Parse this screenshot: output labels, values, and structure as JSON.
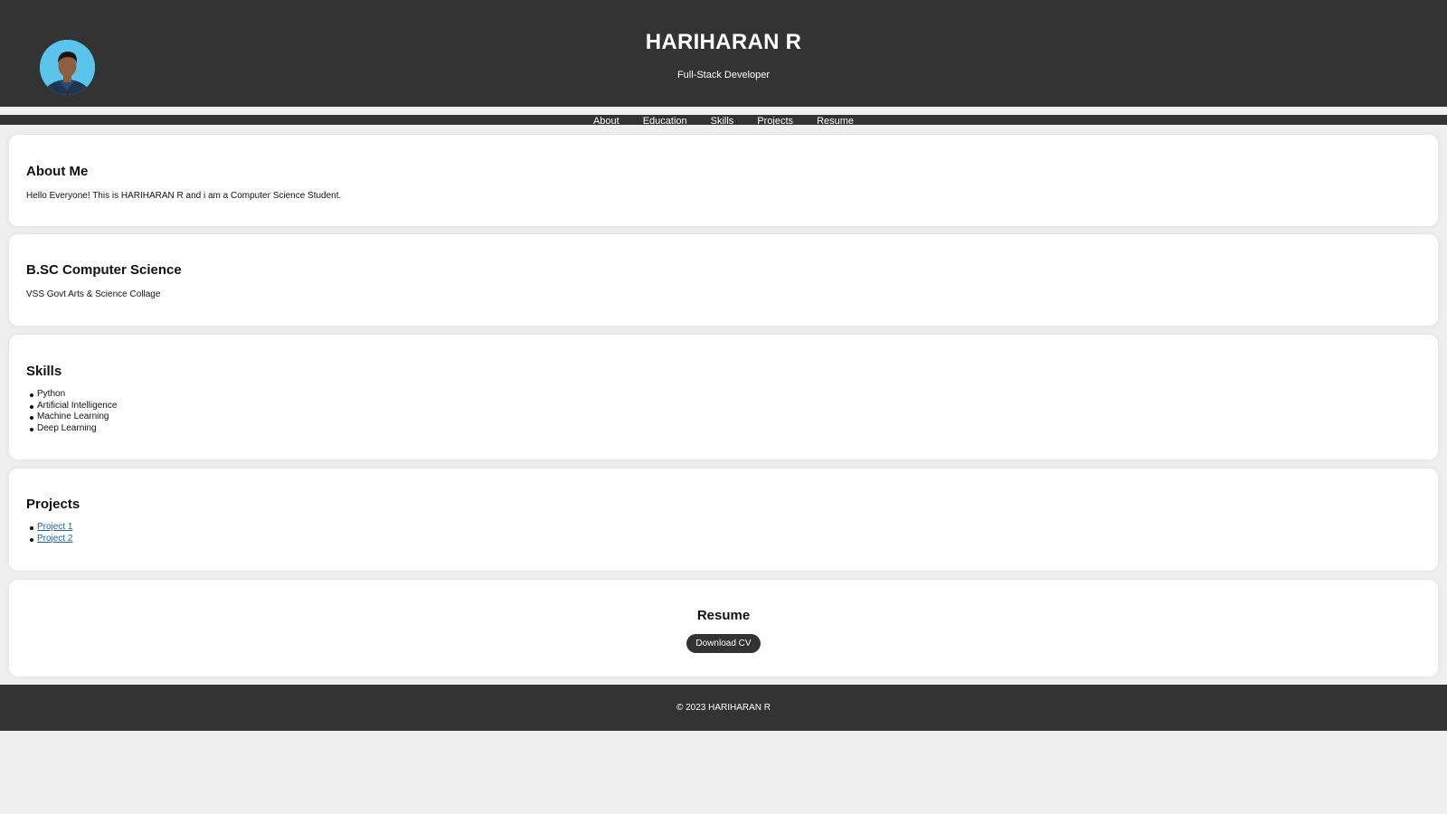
{
  "header": {
    "name": "HARIHARAN R",
    "role": "Full-Stack Developer",
    "avatar_icon": "profile-photo"
  },
  "nav": {
    "items": [
      "About",
      "Education",
      "Skills",
      "Projects",
      "Resume"
    ]
  },
  "about": {
    "title": "About Me",
    "text": "Hello Everyone! This is HARIHARAN R and i am a Computer Science Student."
  },
  "education": {
    "title": "B.SC Computer Science",
    "text": "VSS Govt Arts & Science Collage"
  },
  "skills": {
    "title": "Skills",
    "items": [
      "Python",
      "Artificial Intelligence",
      "Machine Learning",
      "Deep Learning"
    ]
  },
  "projects": {
    "title": "Projects",
    "items": [
      "Project 1",
      "Project 2"
    ]
  },
  "resume": {
    "title": "Resume",
    "button_label": "Download CV"
  },
  "footer": {
    "text": "© 2023 HARIHARAN R"
  },
  "colors": {
    "dark": "#333333",
    "background": "#efefef",
    "card": "#ffffff",
    "link": "#1a5fb4"
  }
}
